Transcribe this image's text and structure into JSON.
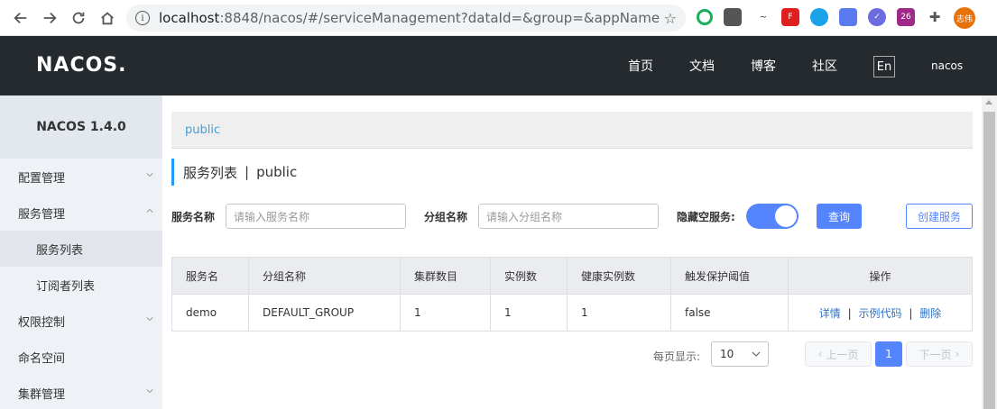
{
  "browser": {
    "url_host": "localhost",
    "url_path": ":8848/nacos/#/serviceManagement?dataId=&group=&appName=&n...",
    "avatar_text": "志伟",
    "ext_badge": "26"
  },
  "header": {
    "logo": "NACOS.",
    "nav": [
      "首页",
      "文档",
      "博客",
      "社区"
    ],
    "lang": "En",
    "user": "nacos"
  },
  "sidebar": {
    "title": "NACOS 1.4.0",
    "items": [
      {
        "label": "配置管理"
      },
      {
        "label": "服务管理"
      },
      {
        "label": "服务列表"
      },
      {
        "label": "订阅者列表"
      },
      {
        "label": "权限控制"
      },
      {
        "label": "命名空间"
      },
      {
        "label": "集群管理"
      }
    ]
  },
  "main": {
    "breadcrumb": "public",
    "title": "服务列表",
    "title_sep": "|",
    "title_ns": "public",
    "filters": {
      "service_label": "服务名称",
      "service_placeholder": "请输入服务名称",
      "group_label": "分组名称",
      "group_placeholder": "请输入分组名称",
      "hide_empty_label": "隐藏空服务:",
      "query_button": "查询",
      "create_button": "创建服务"
    },
    "table": {
      "headers": [
        "服务名",
        "分组名称",
        "集群数目",
        "实例数",
        "健康实例数",
        "触发保护阈值",
        "操作"
      ],
      "rows": [
        {
          "name": "demo",
          "group": "DEFAULT_GROUP",
          "clusters": "1",
          "instances": "1",
          "healthy": "1",
          "threshold": "false",
          "op_detail": "详情",
          "op_code": "示例代码",
          "op_delete": "删除"
        }
      ],
      "op_sep": "|"
    },
    "pager": {
      "label": "每页显示:",
      "page_size": "10",
      "prev": "上一页",
      "current": "1",
      "next": "下一页"
    }
  }
}
